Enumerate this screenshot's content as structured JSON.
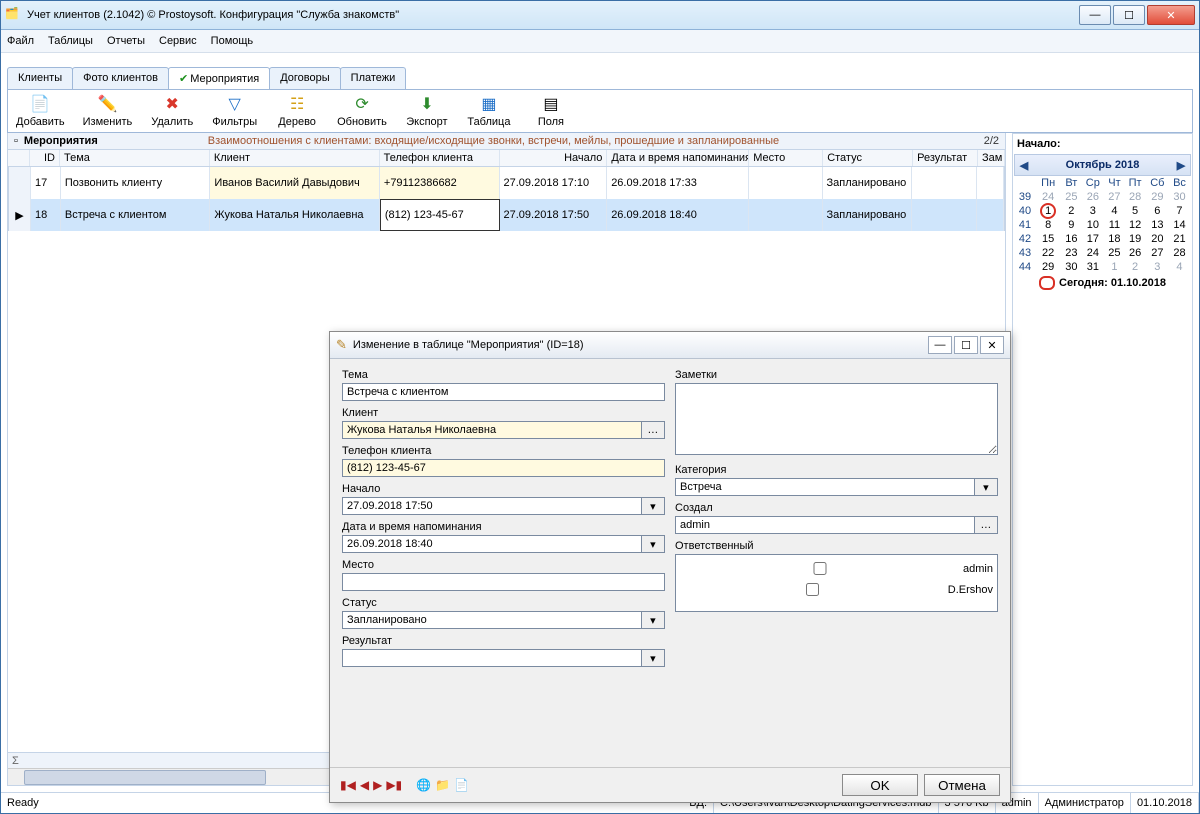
{
  "window": {
    "title": "Учет клиентов (2.1042) © Prostoysoft. Конфигурация \"Служба знакомств\""
  },
  "menu": {
    "file": "Файл",
    "tables": "Таблицы",
    "reports": "Отчеты",
    "service": "Сервис",
    "help": "Помощь"
  },
  "tabs": {
    "clients": "Клиенты",
    "photos": "Фото клиентов",
    "events": "Мероприятия",
    "contracts": "Договоры",
    "payments": "Платежи"
  },
  "toolbar": {
    "add": "Добавить",
    "edit": "Изменить",
    "delete": "Удалить",
    "filters": "Фильтры",
    "tree": "Дерево",
    "refresh": "Обновить",
    "export": "Экспорт",
    "table": "Таблица",
    "fields": "Поля"
  },
  "grid": {
    "title": "Мероприятия",
    "desc": "Взаимоотношения с клиентами: входящие/исходящие звонки, встречи, мейлы, прошедшие и запланированные",
    "counter": "2/2",
    "cols": {
      "id": "ID",
      "topic": "Тема",
      "client": "Клиент",
      "phone": "Телефон клиента",
      "start": "Начало",
      "remind": "Дата и время напоминания",
      "place": "Место",
      "status": "Статус",
      "result": "Результат",
      "note": "Зам"
    },
    "rows": [
      {
        "id": "17",
        "topic": "Позвонить клиенту",
        "client": "Иванов Василий Давыдович",
        "phone": "+79112386682",
        "start": "27.09.2018 17:10",
        "remind": "26.09.2018 17:33",
        "place": "",
        "status": "Запланировано",
        "result": "",
        "note": ""
      },
      {
        "id": "18",
        "topic": "Встреча с клиентом",
        "client": "Жукова Наталья Николаевна",
        "phone": "(812) 123-45-67",
        "start": "27.09.2018 17:50",
        "remind": "26.09.2018 18:40",
        "place": "",
        "status": "Запланировано",
        "result": "",
        "note": ""
      }
    ]
  },
  "calendar": {
    "panelTitle": "Начало:",
    "monthLabel": "Октябрь 2018",
    "dow": [
      "Пн",
      "Вт",
      "Ср",
      "Чт",
      "Пт",
      "Сб",
      "Вс"
    ],
    "weeks": [
      {
        "wk": "39",
        "days": [
          {
            "d": "24",
            "o": 1
          },
          {
            "d": "25",
            "o": 1
          },
          {
            "d": "26",
            "o": 1
          },
          {
            "d": "27",
            "o": 1
          },
          {
            "d": "28",
            "o": 1
          },
          {
            "d": "29",
            "o": 1
          },
          {
            "d": "30",
            "o": 1
          }
        ]
      },
      {
        "wk": "40",
        "days": [
          {
            "d": "1",
            "today": 1
          },
          {
            "d": "2"
          },
          {
            "d": "3"
          },
          {
            "d": "4"
          },
          {
            "d": "5"
          },
          {
            "d": "6"
          },
          {
            "d": "7"
          }
        ]
      },
      {
        "wk": "41",
        "days": [
          {
            "d": "8"
          },
          {
            "d": "9"
          },
          {
            "d": "10"
          },
          {
            "d": "11"
          },
          {
            "d": "12"
          },
          {
            "d": "13"
          },
          {
            "d": "14"
          }
        ]
      },
      {
        "wk": "42",
        "days": [
          {
            "d": "15"
          },
          {
            "d": "16"
          },
          {
            "d": "17"
          },
          {
            "d": "18"
          },
          {
            "d": "19"
          },
          {
            "d": "20"
          },
          {
            "d": "21"
          }
        ]
      },
      {
        "wk": "43",
        "days": [
          {
            "d": "22"
          },
          {
            "d": "23"
          },
          {
            "d": "24"
          },
          {
            "d": "25"
          },
          {
            "d": "26"
          },
          {
            "d": "27"
          },
          {
            "d": "28"
          }
        ]
      },
      {
        "wk": "44",
        "days": [
          {
            "d": "29"
          },
          {
            "d": "30"
          },
          {
            "d": "31"
          },
          {
            "d": "1",
            "o": 1
          },
          {
            "d": "2",
            "o": 1
          },
          {
            "d": "3",
            "o": 1
          },
          {
            "d": "4",
            "o": 1
          }
        ]
      }
    ],
    "todayLabel": "Сегодня: 01.10.2018"
  },
  "dialog": {
    "title": "Изменение в таблице \"Мероприятия\" (ID=18)",
    "labels": {
      "topic": "Тема",
      "client": "Клиент",
      "phone": "Телефон клиента",
      "start": "Начало",
      "remind": "Дата и время напоминания",
      "place": "Место",
      "status": "Статус",
      "result": "Результат",
      "notes": "Заметки",
      "category": "Категория",
      "creator": "Создал",
      "responsible": "Ответственный"
    },
    "values": {
      "topic": "Встреча с клиентом",
      "client": "Жукова Наталья Николаевна",
      "phone": "(812) 123-45-67",
      "start": "27.09.2018 17:50",
      "remind": "26.09.2018 18:40",
      "place": "",
      "status": "Запланировано",
      "result": "",
      "notes": "",
      "category": "Встреча",
      "creator": "admin"
    },
    "responsible": [
      {
        "name": "admin",
        "checked": false
      },
      {
        "name": "D.Ershov",
        "checked": false
      }
    ],
    "buttons": {
      "ok": "OK",
      "cancel": "Отмена"
    }
  },
  "status": {
    "ready": "Ready",
    "dbLabel": "БД:",
    "dbPath": "C:\\Users\\Ivan\\Desktop\\DatingServices.mdb",
    "size": "3 576 Kb",
    "user": "admin",
    "role": "Администратор",
    "date": "01.10.2018"
  }
}
